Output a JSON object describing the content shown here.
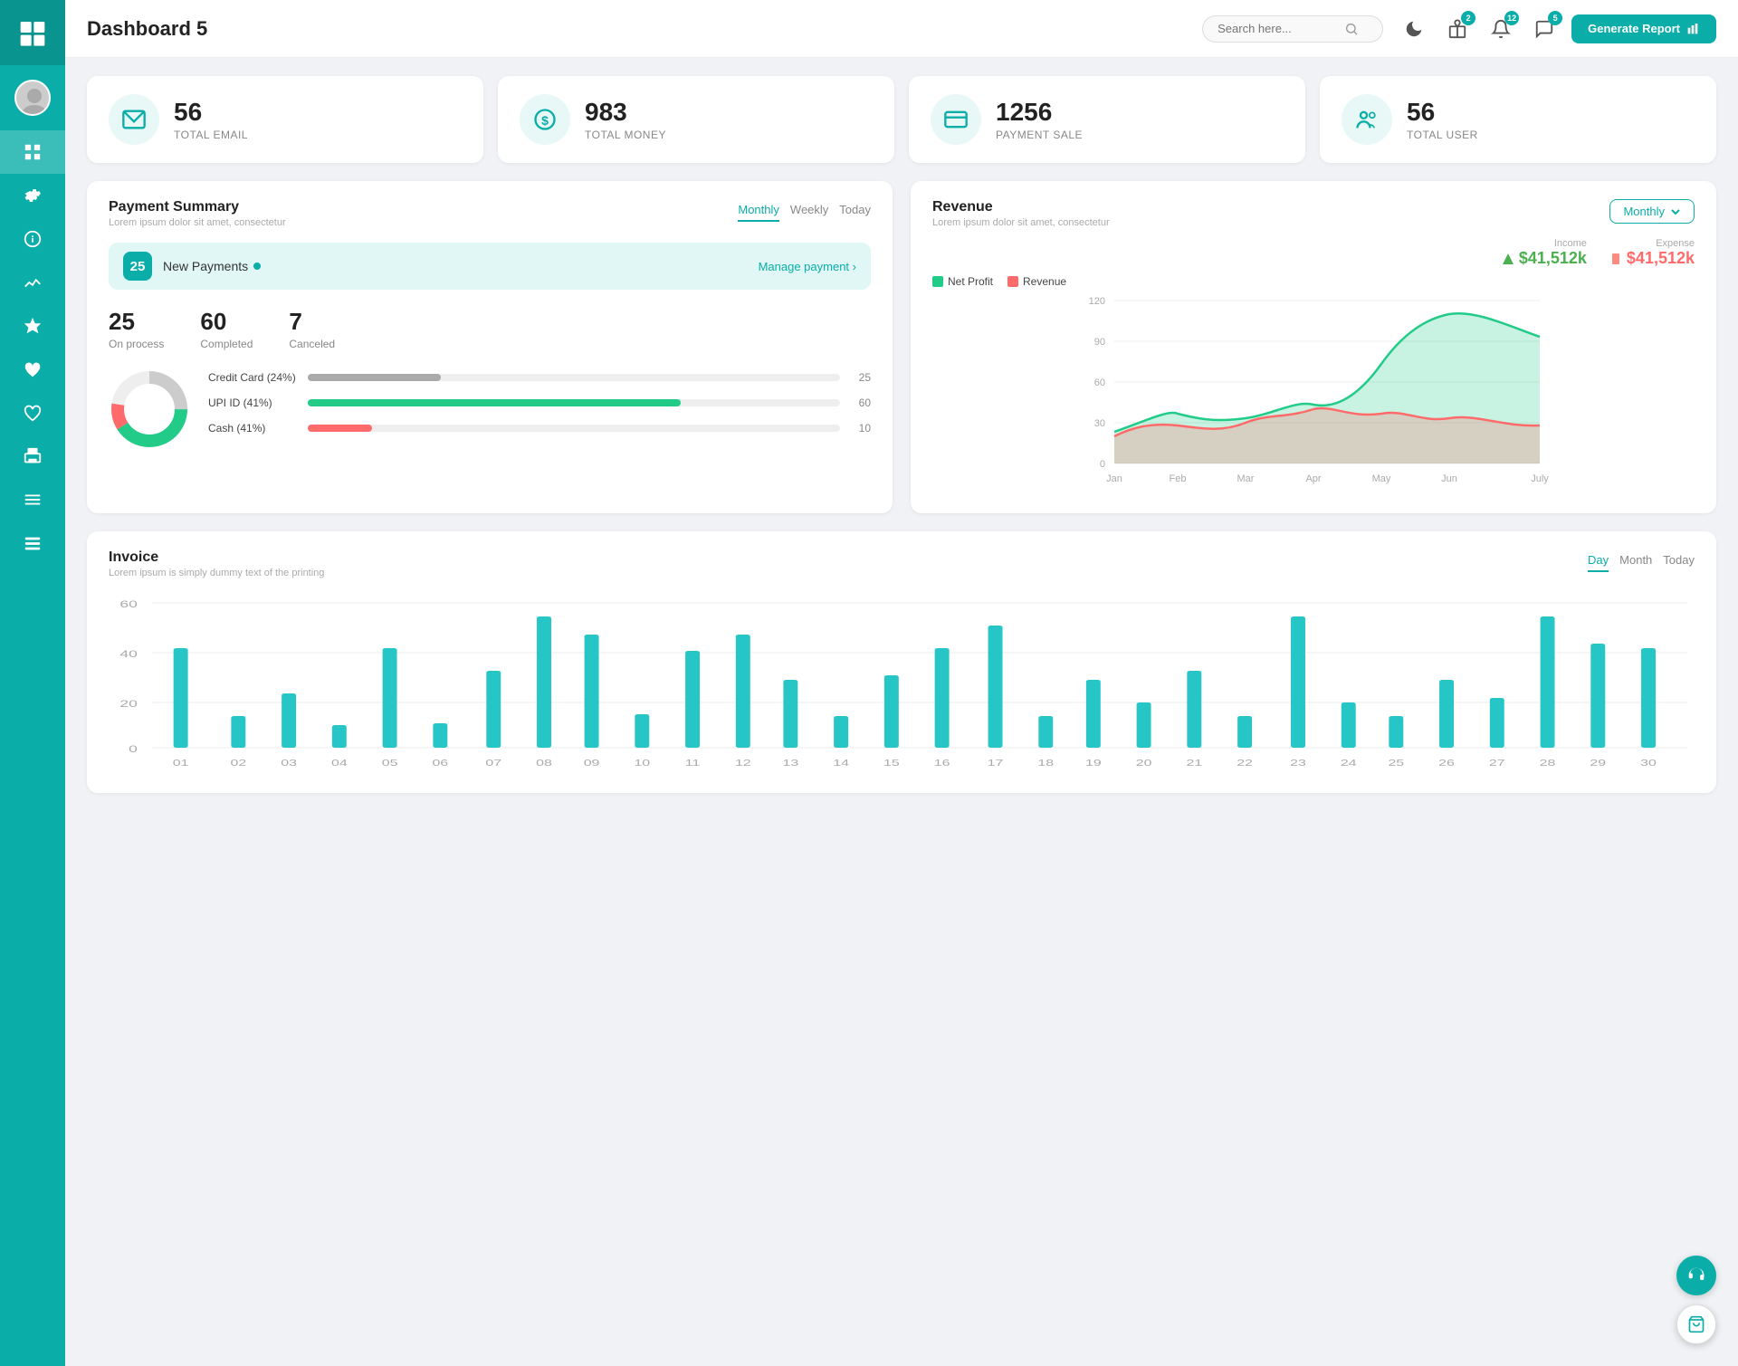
{
  "header": {
    "title": "Dashboard 5",
    "search_placeholder": "Search here...",
    "generate_label": "Generate Report",
    "badge1": "2",
    "badge2": "12",
    "badge3": "5"
  },
  "stat_cards": [
    {
      "value": "56",
      "label": "TOTAL EMAIL",
      "icon": "email"
    },
    {
      "value": "983",
      "label": "TOTAL MONEY",
      "icon": "money"
    },
    {
      "value": "1256",
      "label": "PAYMENT SALE",
      "icon": "card"
    },
    {
      "value": "56",
      "label": "TOTAL USER",
      "icon": "user"
    }
  ],
  "payment_summary": {
    "title": "Payment Summary",
    "subtitle": "Lorem ipsum dolor sit amet, consectetur",
    "tabs": [
      "Monthly",
      "Weekly",
      "Today"
    ],
    "active_tab": "Monthly",
    "new_payments_count": "25",
    "new_payments_label": "New Payments",
    "manage_label": "Manage payment >",
    "stats": [
      {
        "num": "25",
        "label": "On process"
      },
      {
        "num": "60",
        "label": "Completed"
      },
      {
        "num": "7",
        "label": "Canceled"
      }
    ],
    "bars": [
      {
        "label": "Credit Card (24%)",
        "color": "#aaa",
        "width": 25,
        "value": "25"
      },
      {
        "label": "UPI ID (41%)",
        "color": "#22cc88",
        "width": 60,
        "value": "60"
      },
      {
        "label": "Cash (41%)",
        "color": "#FF6B6B",
        "width": 10,
        "value": "10"
      }
    ]
  },
  "revenue": {
    "title": "Revenue",
    "subtitle": "Lorem ipsum dolor sit amet, consectetur",
    "filter": "Monthly",
    "income_label": "Income",
    "income_value": "$41,512k",
    "expense_label": "Expense",
    "expense_value": "$41,512k",
    "legend": [
      {
        "label": "Net Profit",
        "color": "#22cc88"
      },
      {
        "label": "Revenue",
        "color": "#FF6B6B"
      }
    ],
    "x_labels": [
      "Jan",
      "Feb",
      "Mar",
      "Apr",
      "May",
      "Jun",
      "July"
    ],
    "y_labels": [
      "0",
      "30",
      "60",
      "90",
      "120"
    ]
  },
  "invoice": {
    "title": "Invoice",
    "subtitle": "Lorem ipsum is simply dummy text of the printing",
    "tabs": [
      "Day",
      "Month",
      "Today"
    ],
    "active_tab": "Day",
    "x_labels": [
      "01",
      "02",
      "03",
      "04",
      "05",
      "06",
      "07",
      "08",
      "09",
      "10",
      "11",
      "12",
      "13",
      "14",
      "15",
      "16",
      "17",
      "18",
      "19",
      "20",
      "21",
      "22",
      "23",
      "24",
      "25",
      "26",
      "27",
      "28",
      "29",
      "30"
    ],
    "y_labels": [
      "0",
      "20",
      "40",
      "60"
    ],
    "bar_color": "#26C6C6"
  }
}
